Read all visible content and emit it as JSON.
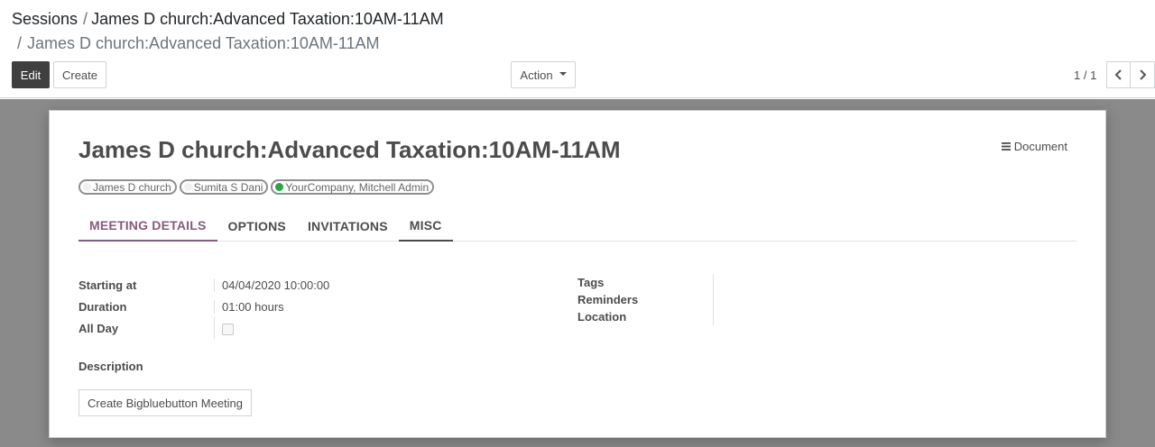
{
  "breadcrumb": {
    "root": "Sessions",
    "separator": "/",
    "level1": "James D church:Advanced Taxation:10AM-11AM",
    "current": "James D church:Advanced Taxation:10AM-11AM"
  },
  "toolbar": {
    "edit_label": "Edit",
    "create_label": "Create",
    "action_label": "Action"
  },
  "pager": {
    "value": "1 / 1"
  },
  "record": {
    "title": "James D church:Advanced Taxation:10AM-11AM",
    "document_label": "Document",
    "attendees": [
      {
        "name": "James D church",
        "online": false
      },
      {
        "name": "Sumita S Dani",
        "online": false
      },
      {
        "name": "YourCompany, Mitchell Admin",
        "online": true
      }
    ]
  },
  "tabs": [
    {
      "label": "MEETING DETAILS",
      "active": true
    },
    {
      "label": "OPTIONS",
      "active": false
    },
    {
      "label": "INVITATIONS",
      "active": false
    },
    {
      "label": "MISC",
      "active": false
    }
  ],
  "details": {
    "starting_at_label": "Starting at",
    "starting_at_value": "04/04/2020 10:00:00",
    "duration_label": "Duration",
    "duration_value": "01:00 hours",
    "all_day_label": "All Day",
    "all_day_checked": false,
    "tags_label": "Tags",
    "reminders_label": "Reminders",
    "location_label": "Location",
    "description_label": "Description",
    "bbb_button_label": "Create Bigbluebutton Meeting"
  },
  "colors": {
    "accent": "#875a7b",
    "edit_button": "#3f3f3f",
    "background": "#8a8a8a",
    "online_dot": "#28a745"
  },
  "icons": {
    "document": "hamburger-menu-icon",
    "pager_prev": "chevron-left-icon",
    "pager_next": "chevron-right-icon",
    "action_caret": "caret-down-icon"
  }
}
